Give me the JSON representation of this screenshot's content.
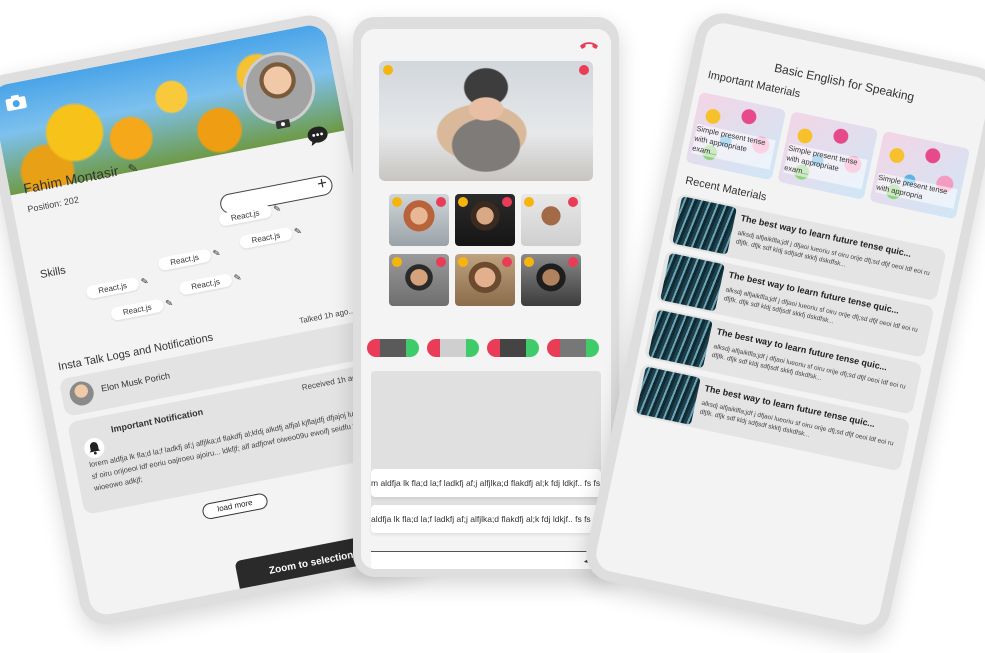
{
  "profile": {
    "name": "Fahim Montasir",
    "position": "Position: 202",
    "skills_title": "Skills",
    "skills": [
      "React.js",
      "React.js",
      "React.js",
      "React.js",
      "React.js",
      "React.js",
      "React.js"
    ],
    "logs_title": "Insta Talk Logs and Notifications",
    "log": {
      "name": "Elon Musk Porich",
      "time": "Talked 1h ago..."
    },
    "notification": {
      "title": "Important Notification",
      "time": "Received 1h ago...",
      "body": "lorem aldfja lk fla;d la;f ladkfj af;j alfjlka;d flakdfj al;kfdj alkdfj alfjal kjflajdfj dfjajoj lueoriu sf oiru orijoeoi ldf eoriu oajiroeu ajoiru... ldkfjf; alf adfjowf oiweo09u ewoifj seidfu wueoif wioeowo adkjf;"
    },
    "load_more": "load more",
    "bottom_bar": "Zoom to selection"
  },
  "call": {
    "message1": "m aldfja lk fla;d la;f ladkfj af;j alfjlka;d flakdfj al;k fdj ldkjf.. fs fs",
    "message2": "aldfja lk fla;d la;f ladkfj af;j alfjlka;d flakdfj al;k fdj ldkjf.. fs fs"
  },
  "course": {
    "title": "Basic English for Speaking",
    "important_title": "Important Materials",
    "materials": [
      "Simple present tense with appropriate exam...",
      "Simple present tense with appropriate exam...",
      "Simple present tense with appropria"
    ],
    "recent_title": "Recent Materials",
    "recent": [
      {
        "title": "The best way to learn future tense quic...",
        "desc": "alksdj alfjaiklfla;jdf j dfjaoi lueoriu sf oiru orije dfj;sd dfjf oeoi ldf eoi ru dfjfk. dfjk sdf kldj sdfjsdf skkfj dskdfsk..."
      },
      {
        "title": "The best way to learn future tense quic...",
        "desc": "alksdj alfjaiklfla;jdf j dfjaoi lueoriu sf oiru orije dfj;sd dfjf oeoi ldf eoi ru dfjfk. dfjk sdf kldj sdfjsdf skkfj dskdfsk..."
      },
      {
        "title": "The best way to learn future tense quic...",
        "desc": "alksdj alfjaiklfla;jdf j dfjaoi lueoriu sf oiru orije dfj;sd dfjf oeoi ldf eoi ru dfjfk. dfjk sdf kldj sdfjsdf skkfj dskdfsk..."
      },
      {
        "title": "The best way to learn future tense quic...",
        "desc": "alksdj alfjaiklfla;jdf j dfjaoi lueoriu sf oiru orije dfj;sd dfjf oeoi ldf eoi ru dfjfk. dfjk sdf kldj sdfjsdf skkfj dskdfsk..."
      }
    ]
  },
  "icons": {
    "camera": "camera-icon",
    "edit": "pencil-icon",
    "chat": "chat-bubble-icon",
    "add": "plus-icon",
    "bell": "bell-icon",
    "end_call": "end-call-icon",
    "send": "send-icon"
  },
  "colors": {
    "mic_on": "#f6b40f",
    "cam_off": "#e93c57",
    "accept": "#3fcb6a",
    "end_call": "#e93c57"
  }
}
